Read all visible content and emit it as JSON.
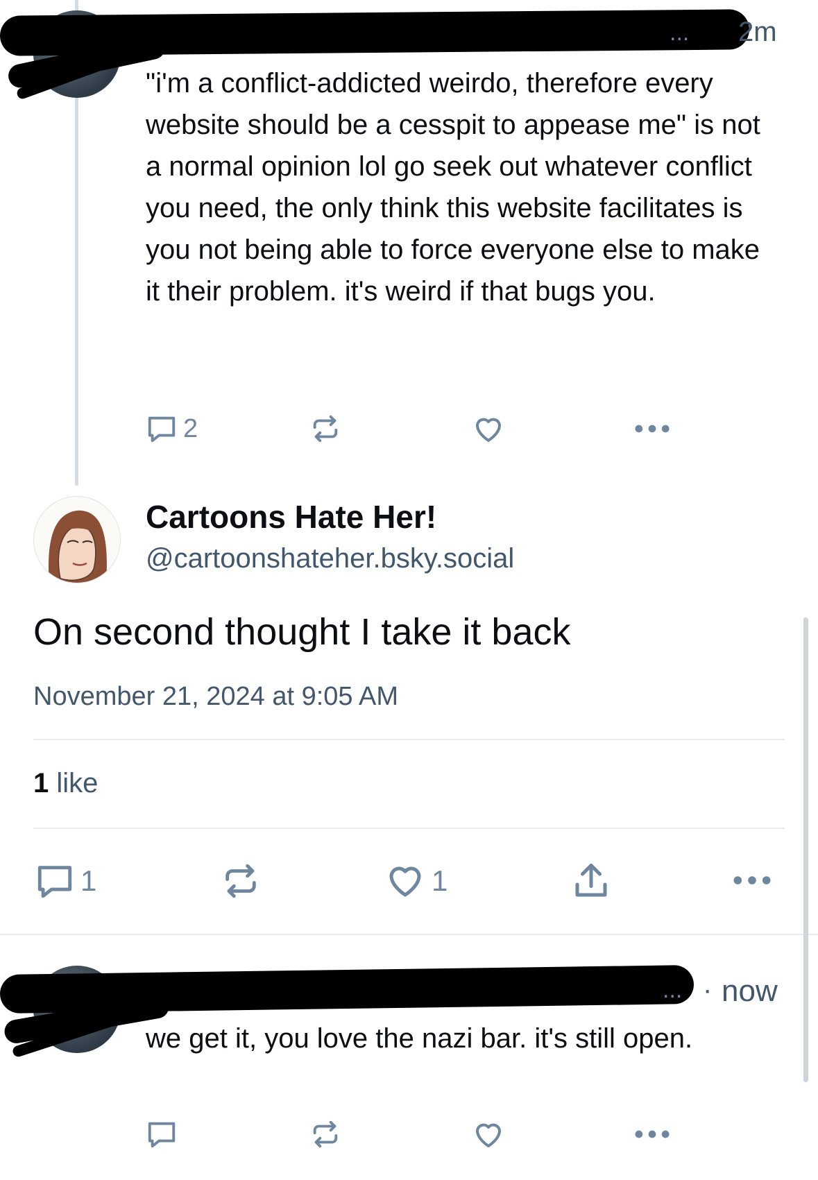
{
  "post1": {
    "time": "2m",
    "handle_fragment": "...",
    "text": "\"i'm a conflict-addicted weirdo, therefore every website should be a cesspit to appease me\" is not a normal opinion lol go seek out whatever conflict you need, the only think this website facilitates is you not being able to force everyone else to make it their problem. it's weird if that bugs you.",
    "replies": "2"
  },
  "main_post": {
    "display_name": "Cartoons Hate Her!",
    "handle": "@cartoonshateher.bsky.social",
    "text": "On second thought I take it back",
    "timestamp": "November 21, 2024 at 9:05 AM",
    "likes_count": "1",
    "likes_label": "like",
    "replies": "1",
    "like_count_action": "1"
  },
  "post3": {
    "time": "now",
    "separator": "·",
    "handle_fragment": "...",
    "text": "we get it, you love the nazi bar. it's still open."
  },
  "colors": {
    "icon": "#6f869f",
    "muted_text": "#42576c",
    "divider": "#e6eaee",
    "thread_line": "#d4dbe2"
  }
}
